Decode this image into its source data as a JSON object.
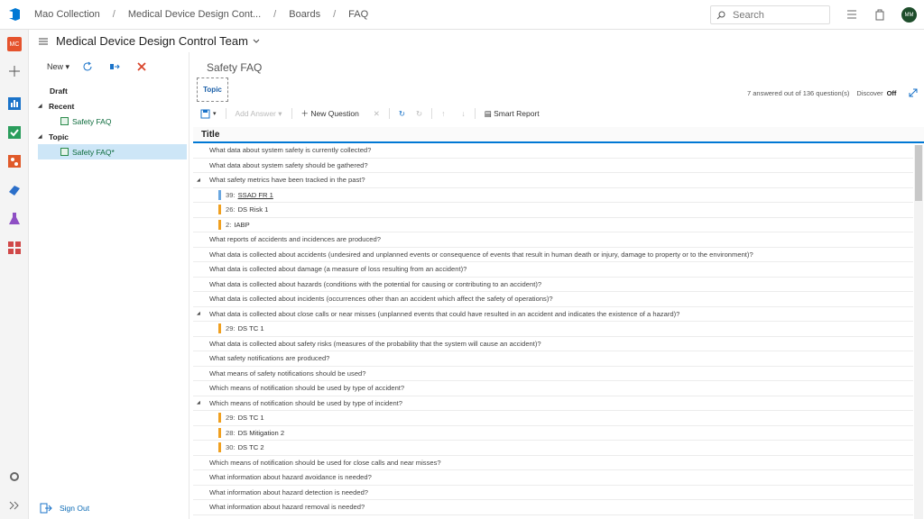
{
  "header": {
    "breadcrumbs": [
      "Mao Collection",
      "Medical Device Design Cont...",
      "Boards",
      "FAQ"
    ],
    "search_placeholder": "Search",
    "avatar_initials": "MM"
  },
  "rail": {
    "project_badge": "MC"
  },
  "team": {
    "name": "Medical Device Design Control Team"
  },
  "left": {
    "toolbar": {
      "new_label": "New"
    },
    "tree": {
      "draft": "Draft",
      "recent": "Recent",
      "recent_item": "Safety FAQ",
      "topic": "Topic",
      "topic_item": "Safety FAQ*"
    },
    "signout": "Sign Out"
  },
  "main": {
    "title": "Safety FAQ",
    "tab": "Topic",
    "status": "7 answered out of 136 question(s)",
    "discover": "Discover",
    "discover_state": "Off",
    "toolbar": {
      "add_answer": "Add Answer",
      "new_question": "New Question",
      "smart_report": "Smart Report"
    },
    "column_title": "Title",
    "rows": [
      {
        "text": "What data about system safety is currently collected?"
      },
      {
        "text": "What data about system safety should be gathered?"
      },
      {
        "text": "What safety metrics have been tracked in the past?",
        "expanded": true
      },
      {
        "child": true,
        "id": "39:",
        "title": "SSAD FR 1",
        "color": "#6aa7e0",
        "underline": true
      },
      {
        "child": true,
        "id": "26:",
        "title": "DS Risk 1",
        "color": "#f0a020"
      },
      {
        "child": true,
        "id": "2:",
        "title": "IABP",
        "color": "#f0a020"
      },
      {
        "text": "What reports of accidents and incidences are produced?"
      },
      {
        "text": "What data is collected about accidents (undesired and unplanned events or consequence of events that result in human death or injury, damage to property or to the environment)?"
      },
      {
        "text": "What data is collected about damage (a measure of loss resulting from an accident)?"
      },
      {
        "text": "What data is collected about hazards (conditions with the potential for causing or contributing to an accident)?"
      },
      {
        "text": "What data is collected about incidents (occurrences other than an accident which affect the safety of operations)?"
      },
      {
        "text": "What data is collected about close calls or near misses (unplanned events that could have resulted in an accident and indicates the existence of a hazard)?",
        "expanded": true
      },
      {
        "child": true,
        "id": "29:",
        "title": "DS TC 1",
        "color": "#f0a020"
      },
      {
        "text": "What data is collected about safety risks (measures of the probability that the system will cause an accident)?"
      },
      {
        "text": "What safety notifications are produced?"
      },
      {
        "text": "What means of safety notifications should be used?"
      },
      {
        "text": "Which means of notification should be used by type of accident?"
      },
      {
        "text": "Which means of notification should be used by type of incident?",
        "expanded": true
      },
      {
        "child": true,
        "id": "29:",
        "title": "DS TC 1",
        "color": "#f0a020"
      },
      {
        "child": true,
        "id": "28:",
        "title": "DS Mitigation 2",
        "color": "#f0a020"
      },
      {
        "child": true,
        "id": "30:",
        "title": "DS TC 2",
        "color": "#f0a020"
      },
      {
        "text": "Which means of notification should be used for close calls and near misses?"
      },
      {
        "text": "What information about hazard avoidance is needed?"
      },
      {
        "text": "What information about hazard detection is needed?"
      },
      {
        "text": "What information about hazard removal is needed?"
      }
    ]
  },
  "colors": {
    "accent": "#0078d4",
    "orange_bar": "#f0a020",
    "blue_bar": "#6aa7e0"
  }
}
